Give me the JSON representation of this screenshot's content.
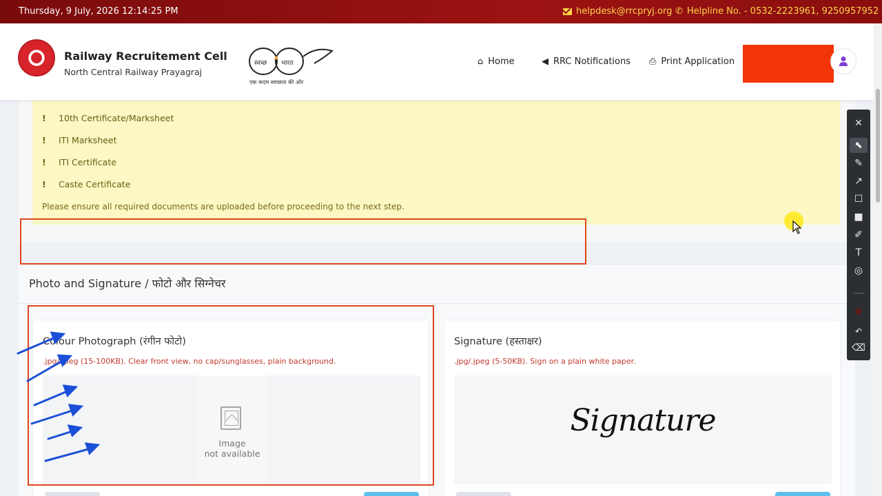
{
  "topbar": {
    "datetime": "Thursday, 9 July, 2026 12:14:25 PM",
    "email": "helpdesk@rrcpryj.org",
    "helpline": "Helpline No. - 0532-2223961, 9250957952"
  },
  "header": {
    "org_title": "Railway Recruitement Cell",
    "org_subtitle": "North Central Railway Prayagraj",
    "swachh_left": "स्वच्छ",
    "swachh_right": "भारत",
    "swachh_tagline": "एक कदम स्वच्छता की ओर",
    "nav": [
      {
        "label": "Home",
        "icon": "home-icon"
      },
      {
        "label": "RRC Notifications",
        "icon": "megaphone-icon"
      },
      {
        "label": "Print Application",
        "icon": "printer-icon"
      }
    ]
  },
  "notice": {
    "items": [
      "10th Certificate/Marksheet",
      "ITI Marksheet",
      "ITI Certificate",
      "Caste Certificate"
    ],
    "bang": "!",
    "note": "Please ensure all required documents are uploaded before proceeding to the next step."
  },
  "photo_section": {
    "title": "Photo and Signature / फोटो और सिग्नेचर",
    "photo": {
      "title": "Colour Photograph (रंगीन फोटो)",
      "hint": ".jpg/.jpeg (15-100KB). Clear front view, no cap/sunglasses, plain background.",
      "placeholder_line1": "Image",
      "placeholder_line2": "not available"
    },
    "signature": {
      "title": "Signature (हस्ताक्षर)",
      "hint": ".jpg/.jpeg (5-50KB). Sign on a plain white paper.",
      "sample_text": "Signature"
    }
  },
  "toolbar": {
    "tools": [
      "close-icon",
      "pointer-icon",
      "pen-icon",
      "arrow-icon",
      "rectangle-icon",
      "filled-rectangle-icon",
      "highlighter-icon",
      "text-icon",
      "stamp-icon",
      "undo-icon",
      "eraser-icon"
    ]
  },
  "colors": {
    "topbar": "#9c1212",
    "accent_yellow": "#ffd54a",
    "notice_bg": "#fbf8c4",
    "annotation_red": "#e0441c",
    "annotation_blue": "#1b4fd8",
    "cta_red": "#f2360a"
  }
}
